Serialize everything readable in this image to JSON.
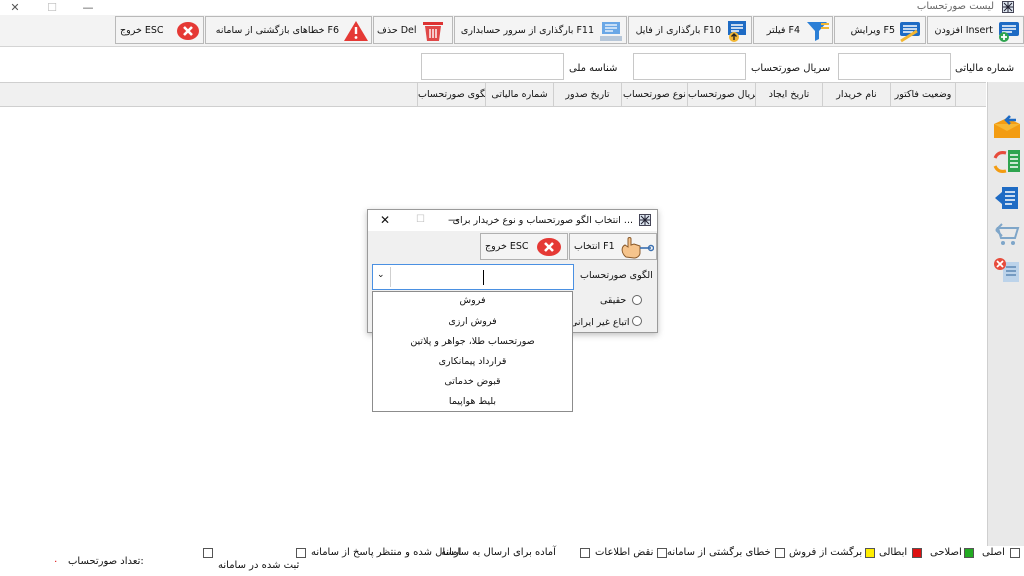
{
  "window": {
    "title": "لیست صورتحساب",
    "close": "✕",
    "maximize": "☐",
    "minimize": "—"
  },
  "toolbar": {
    "add": "افزودن Insert",
    "edit": "ویرایش F5",
    "filter": "فیلتر F4",
    "load_file": "بارگذاری از فایل F10",
    "load_server": "بارگذاری از سرور حسابداری F11",
    "delete": "حذف Del",
    "errors": "خطاهای بازگشتی از سامانه F6",
    "exit": "خروج ESC"
  },
  "filters": {
    "tax_number_label": "شماره مالیاتی",
    "invoice_serial_label": "سریال صورتحساب",
    "national_id_label": "شناسه ملی"
  },
  "grid": {
    "columns": [
      "وضعیت فاکتور",
      "نام خریدار",
      "تاریخ ایجاد",
      "سریال صورتحساب",
      "نوع صورتحساب",
      "تاریخ صدور",
      "شماره مالیاتی",
      "الگوی صورتحساب"
    ]
  },
  "dialog": {
    "title": "انتخاب الگو صورتحساب و نوع خریدار برای ...",
    "select_button": "انتخاب F1",
    "exit_button": "خروج ESC",
    "pattern_label": "الگوی صورتحساب",
    "pattern_value": "",
    "buyer_real": "حقیقی",
    "buyer_foreign": "اتباع غیر ایرانی",
    "close": "✕",
    "maximize": "☐",
    "minimize": "—",
    "dropdown_options": [
      "فروش",
      "فروش ارزی",
      "صورتحساب طلا، جواهر و پلاتین",
      "قرارداد پیمانکاری",
      "قبوض خدماتی",
      "بلیط هواپیما"
    ]
  },
  "legend": {
    "original": "اصلی",
    "corrective": "اصلاحی",
    "cancellation": "ابطالی",
    "sales_return": "برگشت از فروش",
    "system_error": "خطای برگشتی از سامانه",
    "incomplete": "نقض اطلاعات",
    "ready_to_send": "آماده برای ارسال به سامانه",
    "sent_awaiting": "ارسال شده و منتظر پاسخ از سامانه",
    "registered": "ثبت شده در سامانه"
  },
  "footer": {
    "count_label": "تعداد صورتحساب:",
    "count_value": "۰"
  },
  "colors": {
    "corrective": "#22aa22",
    "cancellation": "#dd1111",
    "sales_return": "#ffee00",
    "count_value": "#dd1111"
  }
}
